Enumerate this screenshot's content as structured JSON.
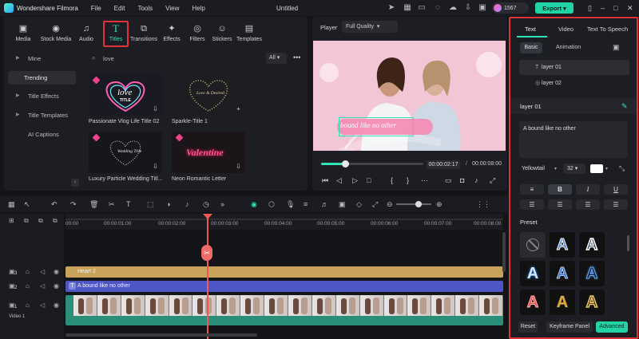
{
  "app": {
    "name": "Wondershare Filmora",
    "doc_title": "Untitled",
    "credits": "1567",
    "export_label": "Export"
  },
  "menu": [
    "File",
    "Edit",
    "Tools",
    "View",
    "Help"
  ],
  "media_tabs": [
    "Media",
    "Stock Media",
    "Audio",
    "Titles",
    "Transitions",
    "Effects",
    "Filters",
    "Stickers",
    "Templates"
  ],
  "sidebar": [
    "Mine",
    "Trending",
    "Title Effects",
    "Title Templates",
    "AI Captions"
  ],
  "search": {
    "value": "love",
    "filter": "All"
  },
  "cards": [
    {
      "label": "Passionate Vlog Life Title 02",
      "art": "love",
      "art2": "TITLE"
    },
    {
      "label": "Sparkle-Title 1",
      "art": "Love & Desired"
    },
    {
      "label": "Luxury Particle Wedding Titl...",
      "art": "Wedding Title"
    },
    {
      "label": "Neon Romantic Letter",
      "art": "Valentine"
    }
  ],
  "player": {
    "label": "Player",
    "quality": "Full Quality",
    "current_time": "00:00:02:17",
    "total_time": "00:00:08:00",
    "overlay_text": "bound like no other",
    "progress": 0.23
  },
  "props": {
    "tabs": [
      "Text",
      "Video",
      "Text To Speech"
    ],
    "subtabs": [
      "Basic",
      "Animation"
    ],
    "layers": [
      "layer 01",
      "layer 02"
    ],
    "selected_layer": "layer 01",
    "text_value": "A bound like no other",
    "font": "Yellowtail",
    "size": "32",
    "format_buttons": [
      "B",
      "I",
      "U"
    ],
    "preset_label": "Preset",
    "buttons": {
      "reset": "Reset",
      "keyframe": "Keyframe Panel",
      "advanced": "Advanced"
    }
  },
  "timeline": {
    "ticks": [
      "00:00",
      "00:00:01:00",
      "00:00:02:00",
      "00:00:03:00",
      "00:00:04:00",
      "00:00:05:00",
      "00:00:06:00",
      "00:00:07:00",
      "00:00:08:00"
    ],
    "clips": {
      "heart": "Heart 2",
      "text": "A bound like no other"
    },
    "track_labels": [
      "3",
      "2",
      "1"
    ],
    "video_label": "Video 1"
  },
  "colors": {
    "accent": "#22d3a6",
    "highlight": "#e0323a",
    "text_clip": "#4d56c4",
    "heart_clip": "#c9a35a",
    "video_clip": "#2a8e78",
    "playhead": "#f25757"
  }
}
